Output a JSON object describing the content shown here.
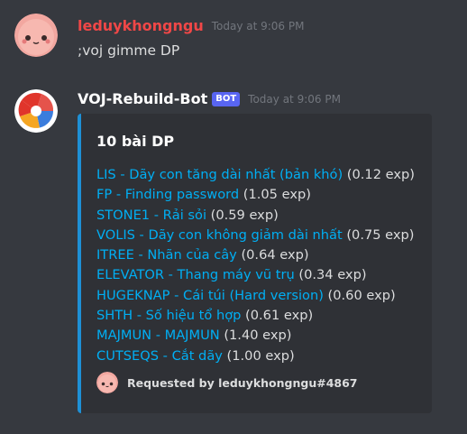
{
  "messages": [
    {
      "author": "leduykhongngu",
      "author_color": "#f04747",
      "timestamp": "Today at 9:06 PM",
      "content": ";voj gimme DP",
      "avatar_icon": "pink-face-avatar"
    },
    {
      "author": "VOJ-Rebuild-Bot",
      "author_color": "#ffffff",
      "badge": "BOT",
      "timestamp": "Today at 9:06 PM",
      "avatar_icon": "voj-logo-avatar",
      "embed": {
        "accent_color": "#1e90d6",
        "title": "10 bài DP",
        "items": [
          {
            "link": "LIS - Dãy con tăng dài nhất (bản khó)",
            "exp": " (0.12 exp)"
          },
          {
            "link": "FP - Finding password",
            "exp": " (1.05 exp)"
          },
          {
            "link": "STONE1 - Rải sỏi",
            "exp": " (0.59 exp)"
          },
          {
            "link": "VOLIS - Dãy con không giảm dài nhất",
            "exp": " (0.75 exp)"
          },
          {
            "link": "ITREE - Nhãn của cây",
            "exp": " (0.64 exp)"
          },
          {
            "link": "ELEVATOR - Thang máy vũ trụ",
            "exp": " (0.34 exp)"
          },
          {
            "link": "HUGEKNAP - Cái túi (Hard version)",
            "exp": " (0.60 exp)"
          },
          {
            "link": "SHTH - Số hiệu tổ hợp",
            "exp": " (0.61 exp)"
          },
          {
            "link": "MAJMUN - MAJMUN",
            "exp": " (1.40 exp)"
          },
          {
            "link": "CUTSEQS - Cắt dãy",
            "exp": " (1.00 exp)"
          }
        ],
        "footer": "Requested by leduykhongngu#4867"
      }
    }
  ]
}
